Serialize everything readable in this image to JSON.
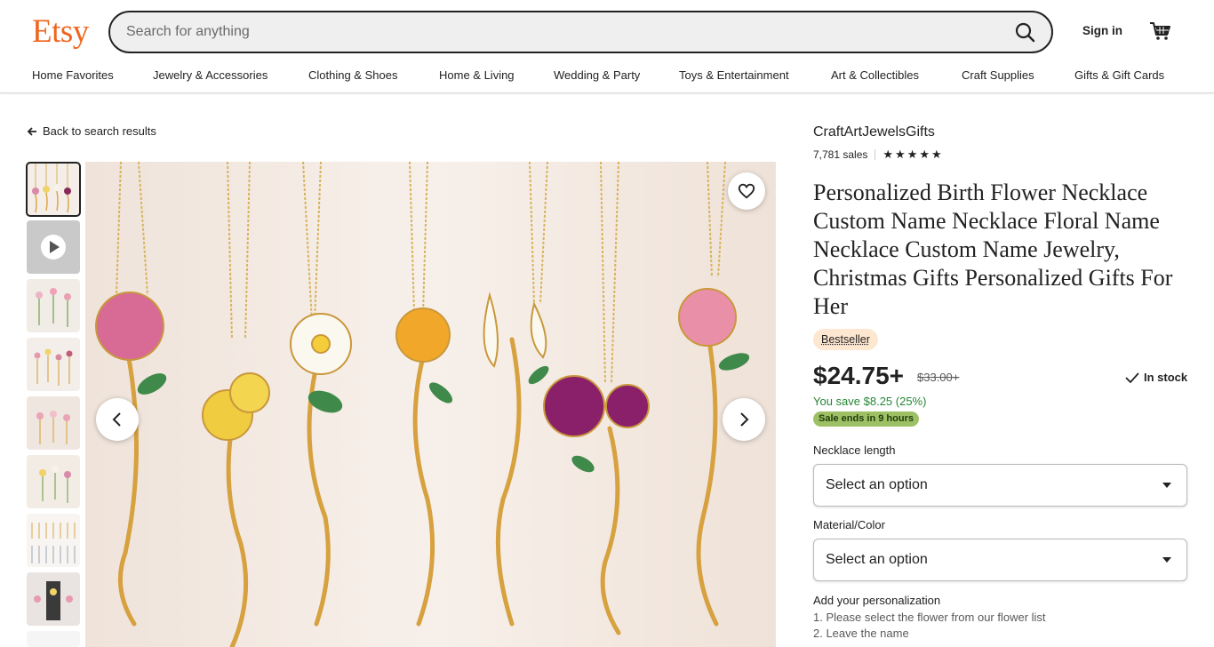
{
  "header": {
    "logo": "Etsy",
    "search_placeholder": "Search for anything",
    "sign_in": "Sign in"
  },
  "nav": [
    "Home Favorites",
    "Jewelry & Accessories",
    "Clothing & Shoes",
    "Home & Living",
    "Wedding & Party",
    "Toys & Entertainment",
    "Art & Collectibles",
    "Craft Supplies",
    "Gifts & Gift Cards"
  ],
  "back_link": "Back to search results",
  "thumbnails": [
    "photo",
    "video",
    "photo",
    "photo",
    "photo",
    "photo",
    "photo",
    "photo",
    "photo"
  ],
  "listing": {
    "shop_name": "CraftArtJewelsGifts",
    "sales": "7,781 sales",
    "rating_stars": 5,
    "title": "Personalized Birth Flower Necklace Custom Name Necklace Floral Name Necklace Custom Name Jewelry, Christmas Gifts Personalized Gifts For Her",
    "badge": "Bestseller",
    "price": "$24.75+",
    "original_price": "$33.00+",
    "stock": "In stock",
    "savings": "You save $8.25 (25%)",
    "sale_ends": "Sale ends in 9 hours",
    "options": [
      {
        "label": "Necklace length",
        "value": "Select an option"
      },
      {
        "label": "Material/Color",
        "value": "Select an option"
      }
    ],
    "personalization": {
      "label": "Add your personalization",
      "lines": [
        "1. Please select the flower from our flower list",
        "2. Leave the name"
      ]
    }
  },
  "colors": {
    "brand": "#f1641e",
    "badge_bg": "#fde7d0",
    "savings_text": "#258635",
    "sale_pill": "#9ec065"
  }
}
